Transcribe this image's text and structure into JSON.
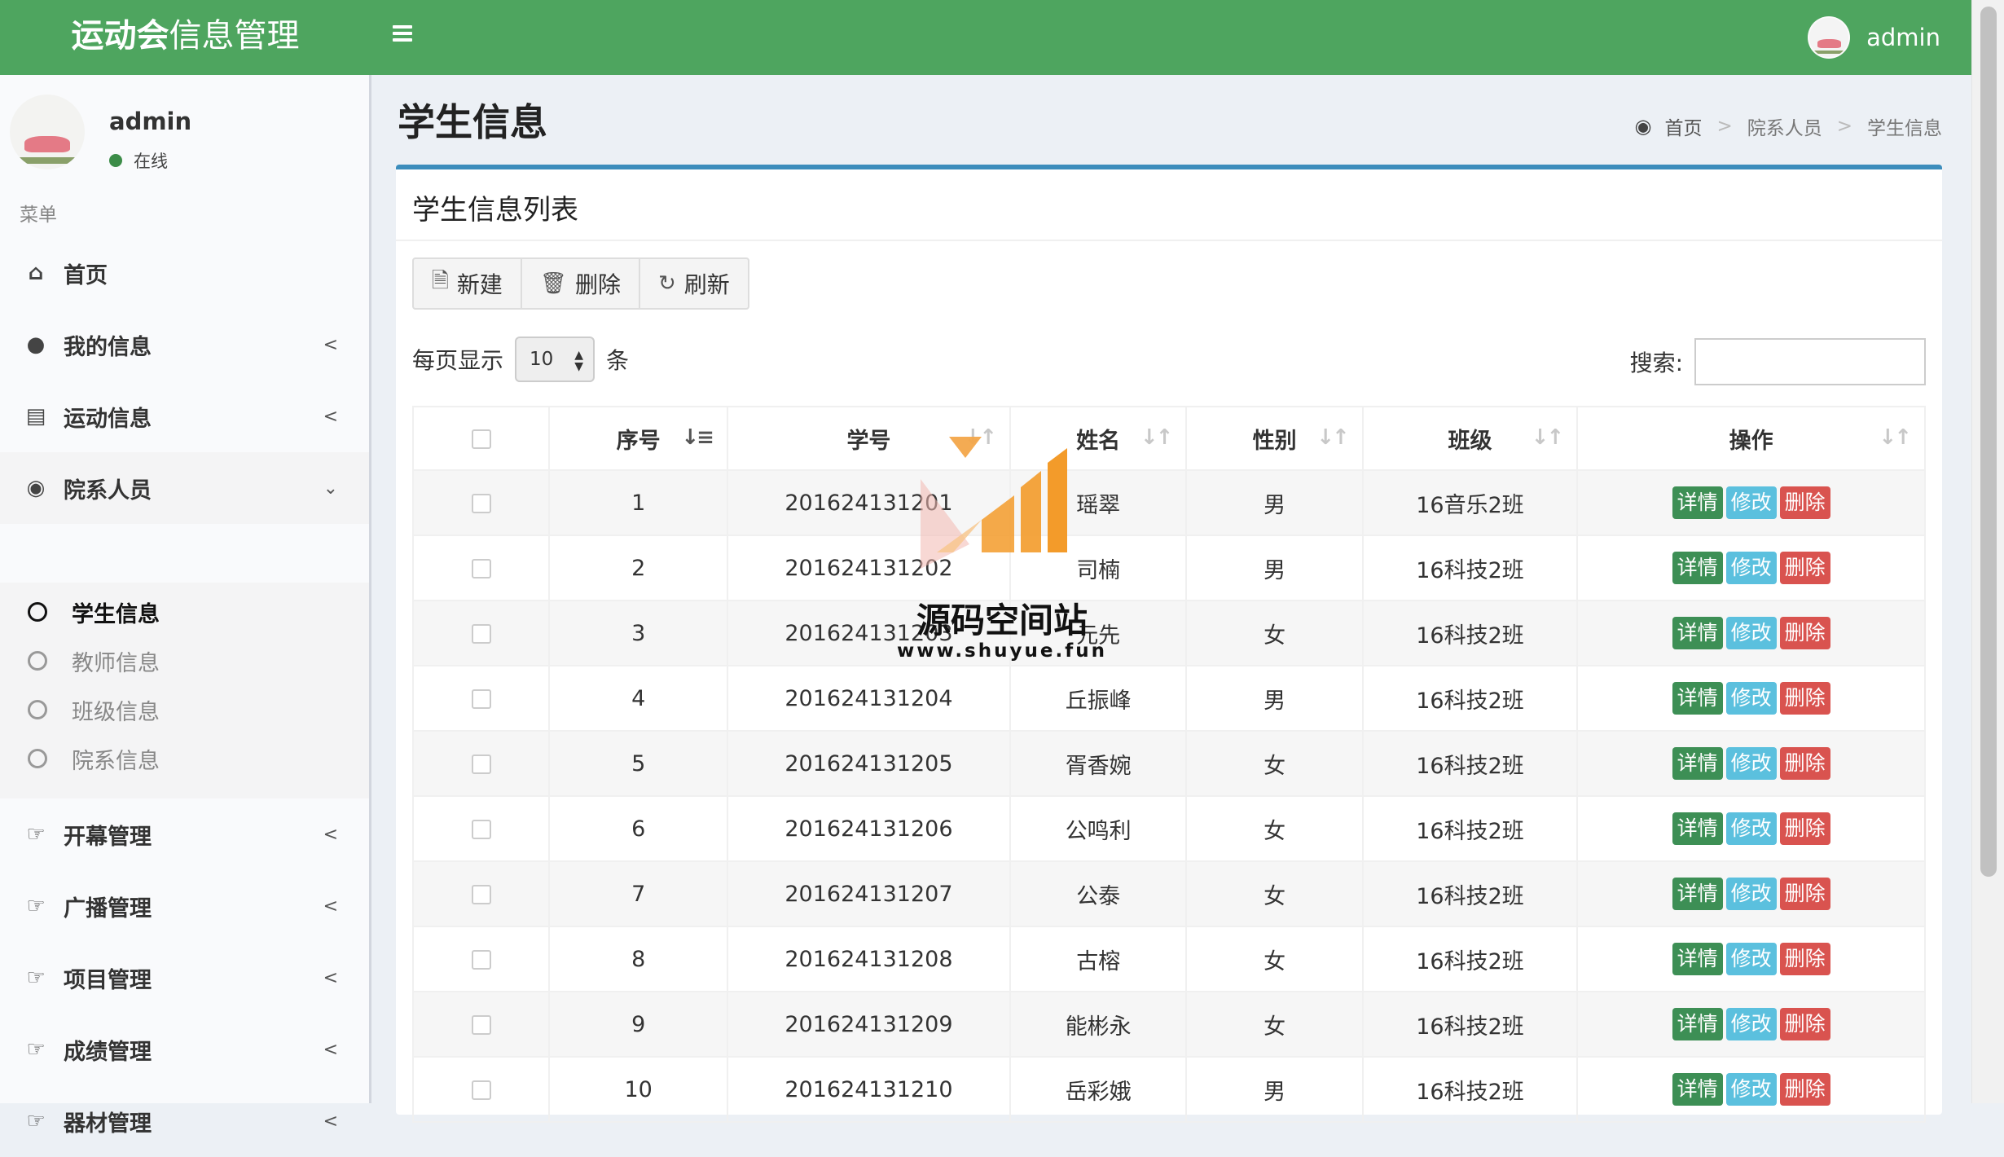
{
  "app": {
    "logo_bold": "运动会",
    "logo_rest": "信息管理",
    "user_name": "admin"
  },
  "sidebar": {
    "user_name": "admin",
    "status": "在线",
    "menu_header": "菜单",
    "items": [
      {
        "label": "首页",
        "icon": "home-icon"
      },
      {
        "label": "我的信息",
        "icon": "user-icon"
      },
      {
        "label": "运动信息",
        "icon": "bar-chart-icon"
      },
      {
        "label": "院系人员",
        "icon": "users-icon"
      },
      {
        "label": "开幕管理",
        "icon": "thumbs-up-icon"
      },
      {
        "label": "广播管理",
        "icon": "thumbs-up-icon"
      },
      {
        "label": "项目管理",
        "icon": "thumbs-up-icon"
      },
      {
        "label": "成绩管理",
        "icon": "thumbs-up-icon"
      },
      {
        "label": "器材管理",
        "icon": "thumbs-up-icon"
      }
    ],
    "subitems": [
      "学生信息",
      "教师信息",
      "班级信息",
      "院系信息"
    ]
  },
  "page": {
    "title": "学生信息",
    "breadcrumb": [
      "首页",
      "院系人员",
      "学生信息"
    ]
  },
  "panel": {
    "title": "学生信息列表",
    "btn_new": "新建",
    "btn_delete": "删除",
    "btn_refresh": "刷新",
    "length_prefix": "每页显示",
    "length_value": "10",
    "length_suffix": "条",
    "search_label": "搜索:"
  },
  "table": {
    "headers": [
      "序号",
      "学号",
      "姓名",
      "性别",
      "班级",
      "操作"
    ],
    "actions": {
      "detail": "详情",
      "edit": "修改",
      "delete": "删除"
    },
    "rows": [
      [
        "1",
        "201624131201",
        "瑶翠",
        "男",
        "16音乐2班"
      ],
      [
        "2",
        "201624131202",
        "司楠",
        "男",
        "16科技2班"
      ],
      [
        "3",
        "201624131203",
        "元先",
        "女",
        "16科技2班"
      ],
      [
        "4",
        "201624131204",
        "丘振峰",
        "男",
        "16科技2班"
      ],
      [
        "5",
        "201624131205",
        "胥香婉",
        "女",
        "16科技2班"
      ],
      [
        "6",
        "201624131206",
        "公鸣利",
        "女",
        "16科技2班"
      ],
      [
        "7",
        "201624131207",
        "公泰",
        "女",
        "16科技2班"
      ],
      [
        "8",
        "201624131208",
        "古榕",
        "女",
        "16科技2班"
      ],
      [
        "9",
        "201624131209",
        "能彬永",
        "女",
        "16科技2班"
      ],
      [
        "10",
        "201624131210",
        "岳彩娥",
        "男",
        "16科技2班"
      ]
    ]
  },
  "watermark": {
    "text": "源码空间站",
    "url": "www.shuyue.fun"
  },
  "colors": {
    "topbar": "#4ea55f",
    "accent": "#3c8dbc",
    "detail": "#3d8f55",
    "edit": "#5bc0de",
    "delete": "#d9534f"
  }
}
